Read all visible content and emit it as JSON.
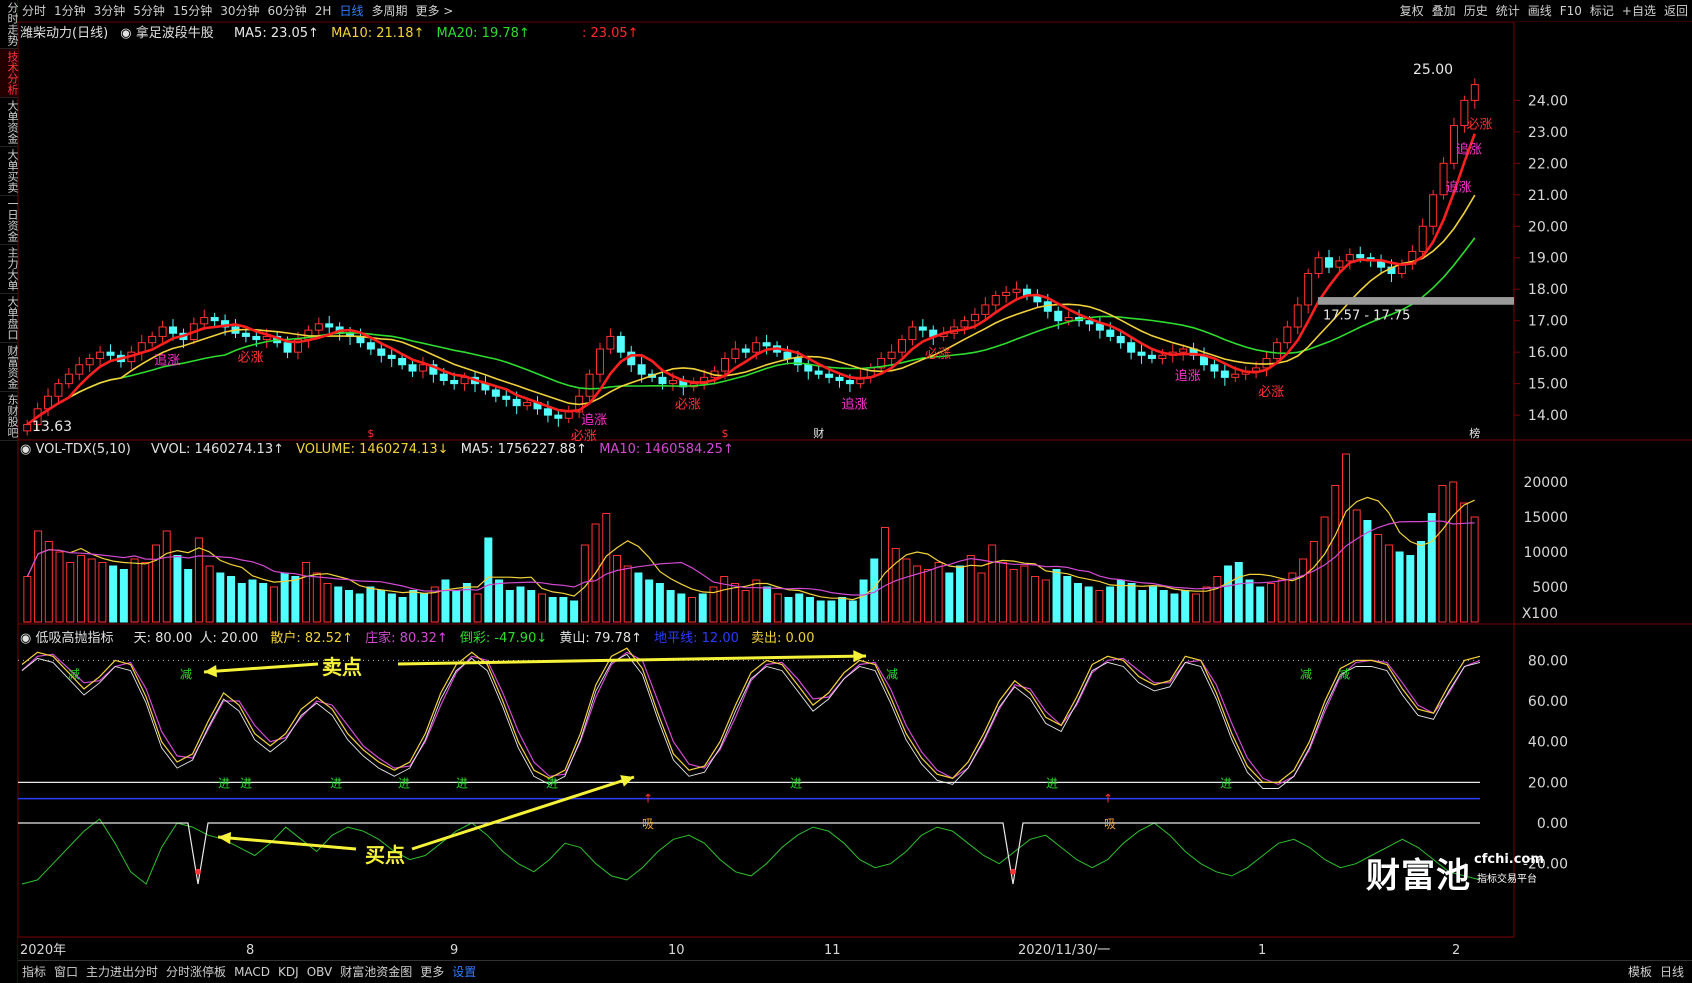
{
  "toolbar": {
    "left_items": [
      "分时",
      "1分钟",
      "3分钟",
      "5分钟",
      "15分钟",
      "30分钟",
      "60分钟",
      "2H",
      "日线",
      "多周期",
      "更多 >"
    ],
    "active": "日线",
    "right_items": [
      "复权",
      "叠加",
      "历史",
      "统计",
      "画线",
      "F10",
      "标记",
      "+自选",
      "返回"
    ]
  },
  "sidebar": {
    "items": [
      "分时走势",
      "技术分析",
      "大单资金",
      "大单买卖",
      "一日资金",
      "主力大单",
      "大单盘口",
      "财富资金",
      "东财股吧"
    ],
    "active": "技术分析"
  },
  "price_panel": {
    "legend": {
      "stock": "潍柴动力(日线)",
      "indicator": "拿足波段牛股",
      "ma5": "MA5: 23.05↑",
      "ma10": "MA10: 21.18↑",
      "ma20": "MA20: 19.78↑",
      "extra": ": 23.05↑"
    },
    "max_label": "25.00",
    "min_label": "13.63",
    "range_label": "17.57 - 17.75",
    "signals": [
      "追涨",
      "必涨",
      "必涨",
      "追涨",
      "必涨",
      "追涨",
      "必涨",
      "追涨",
      "必涨",
      "追涨",
      "必涨",
      "追涨"
    ],
    "markers": [
      "$",
      "$",
      "财",
      "榜"
    ]
  },
  "volume_panel": {
    "legend": {
      "name": "VOL-TDX(5,10)",
      "vvol": "VVOL: 1460274.13↑",
      "volume": "VOLUME: 1460274.13↓",
      "ma5": "MA5: 1756227.88↑",
      "ma10": "MA10: 1460584.25↑"
    },
    "unit": "X100"
  },
  "osc_panel": {
    "legend": {
      "name": "低吸高抛指标",
      "tian": "天: 80.00",
      "ren": "人: 20.00",
      "sanhu": "散户: 82.52↑",
      "zhuangjia": "庄家: 80.32↑",
      "daogua": "倒彩: -47.90↓",
      "huangshan": "黄山: 79.78↑",
      "dipingxian": "地平线: 12.00",
      "maichu": "卖出: 0.00"
    },
    "sell_label": "卖点",
    "buy_label": "买点",
    "jin_label": "进",
    "jian_label": "减",
    "xi_label": "吸"
  },
  "x_axis": {
    "labels": [
      "2020年",
      "8",
      "9",
      "10",
      "11",
      "2020/11/30/一",
      "1",
      "2"
    ]
  },
  "bottombar": {
    "items": [
      "指标",
      "窗口",
      "主力进出分时",
      "分时涨停板",
      "MACD",
      "KDJ",
      "OBV",
      "财富池资金图",
      "更多",
      "设置"
    ],
    "active": "设置",
    "right_items": [
      "模板",
      "日线"
    ]
  },
  "watermark": {
    "brand": "财富池",
    "domain": "cfchi.com",
    "tagline": "指标交易平台"
  },
  "chart_data": [
    {
      "type": "candlestick",
      "title": "潍柴动力(日线)",
      "y_ticks": [
        24.0,
        23.0,
        22.0,
        21.0,
        20.0,
        19.0,
        18.0,
        17.0,
        16.0,
        15.0,
        14.0
      ],
      "ylim": [
        13.4,
        25.6
      ],
      "close": [
        13.7,
        14.2,
        14.6,
        15.0,
        15.3,
        15.6,
        15.8,
        16.0,
        15.9,
        15.7,
        16.0,
        16.3,
        16.5,
        16.8,
        16.6,
        16.4,
        16.9,
        17.1,
        17.0,
        16.8,
        16.6,
        16.5,
        16.4,
        16.5,
        16.3,
        16.0,
        16.4,
        16.7,
        16.9,
        16.8,
        16.6,
        16.5,
        16.3,
        16.1,
        15.9,
        15.8,
        15.6,
        15.4,
        15.6,
        15.3,
        15.1,
        15.0,
        15.2,
        15.0,
        14.8,
        14.6,
        14.5,
        14.3,
        14.4,
        14.2,
        14.0,
        13.9,
        14.1,
        14.6,
        15.3,
        16.1,
        16.5,
        16.0,
        15.6,
        15.3,
        15.2,
        15.0,
        15.1,
        14.9,
        15.0,
        15.2,
        15.4,
        15.8,
        16.1,
        16.0,
        16.3,
        16.2,
        16.0,
        15.8,
        15.6,
        15.4,
        15.3,
        15.2,
        15.1,
        15.0,
        15.2,
        15.5,
        15.8,
        16.0,
        16.4,
        16.8,
        16.7,
        16.5,
        16.6,
        16.8,
        17.0,
        17.2,
        17.5,
        17.8,
        17.9,
        18.0,
        17.8,
        17.6,
        17.3,
        17.0,
        17.1,
        17.0,
        16.9,
        16.7,
        16.5,
        16.3,
        16.0,
        15.9,
        15.8,
        15.9,
        16.0,
        16.1,
        15.9,
        15.6,
        15.4,
        15.2,
        15.3,
        15.4,
        15.5,
        15.8,
        16.3,
        16.8,
        17.5,
        18.5,
        19.0,
        18.7,
        18.9,
        19.1,
        19.0,
        18.9,
        18.7,
        18.5,
        18.8,
        19.2,
        20.0,
        21.0,
        22.0,
        23.2,
        24.0,
        24.5
      ],
      "ma_lines": [
        "MA5",
        "MA10",
        "MA20"
      ]
    },
    {
      "type": "bar",
      "title": "VOL-TDX(5,10)",
      "y_ticks": [
        20000,
        15000,
        10000,
        5000
      ],
      "ylim": [
        0,
        24000
      ],
      "unit": "X100",
      "values": [
        6500,
        13000,
        11500,
        10000,
        8500,
        9500,
        9000,
        8500,
        8000,
        7500,
        9000,
        8500,
        11000,
        13000,
        9500,
        7500,
        12000,
        8000,
        7000,
        6500,
        5500,
        6000,
        5500,
        5000,
        7000,
        6500,
        8500,
        7000,
        5500,
        5000,
        4500,
        4000,
        5000,
        4500,
        4000,
        3500,
        4500,
        4000,
        5000,
        6000,
        4500,
        5500,
        4000,
        12000,
        6000,
        4500,
        5000,
        4500,
        4000,
        3500,
        3500,
        3000,
        11000,
        14000,
        15500,
        9500,
        8000,
        7000,
        6000,
        5500,
        4500,
        4000,
        3500,
        4000,
        5000,
        6500,
        5500,
        4500,
        6000,
        5000,
        4000,
        3500,
        4000,
        3500,
        3000,
        3000,
        3500,
        3000,
        6000,
        9000,
        13500,
        10500,
        9000,
        8000,
        7500,
        8500,
        7000,
        8000,
        9500,
        7000,
        11000,
        8500,
        7500,
        8000,
        6500,
        6000,
        7500,
        6500,
        5500,
        5000,
        4500,
        5000,
        6000,
        5500,
        4500,
        5000,
        4500,
        4000,
        4500,
        4000,
        5000,
        6500,
        8000,
        8500,
        6000,
        5000,
        5500,
        6000,
        7000,
        9000,
        11500,
        15000,
        19500,
        24000,
        16000,
        14500,
        12500,
        11000,
        10000,
        9500,
        11500,
        15500,
        19500,
        20000,
        17000,
        15000
      ],
      "series": [
        {
          "name": "MA5"
        },
        {
          "name": "MA10"
        }
      ]
    },
    {
      "type": "line",
      "title": "低吸高抛指标",
      "y_ticks": [
        80.0,
        60.0,
        40.0,
        20.0,
        0.0,
        -20.0
      ],
      "ylim": [
        -30,
        92
      ],
      "series": [
        {
          "name": "散户",
          "values": [
            78,
            84,
            82,
            74,
            66,
            72,
            80,
            78,
            62,
            40,
            30,
            34,
            50,
            64,
            58,
            44,
            38,
            44,
            56,
            62,
            56,
            44,
            36,
            30,
            26,
            30,
            44,
            64,
            78,
            84,
            78,
            60,
            40,
            26,
            22,
            26,
            44,
            68,
            82,
            86,
            76,
            54,
            34,
            26,
            28,
            40,
            58,
            74,
            80,
            78,
            68,
            58,
            64,
            74,
            80,
            78,
            62,
            44,
            32,
            24,
            22,
            30,
            44,
            60,
            70,
            64,
            52,
            48,
            62,
            78,
            82,
            80,
            72,
            68,
            70,
            82,
            80,
            64,
            44,
            28,
            20,
            20,
            26,
            40,
            60,
            76,
            80,
            80,
            78,
            66,
            56,
            54,
            68,
            80,
            82
          ]
        },
        {
          "name": "庄家",
          "values": [
            75,
            82,
            83,
            76,
            69,
            70,
            77,
            79,
            66,
            45,
            33,
            32,
            46,
            60,
            60,
            48,
            40,
            42,
            52,
            60,
            58,
            48,
            38,
            32,
            27,
            28,
            40,
            58,
            74,
            82,
            80,
            64,
            45,
            30,
            23,
            24,
            40,
            62,
            78,
            84,
            80,
            60,
            40,
            29,
            27,
            36,
            52,
            70,
            78,
            79,
            71,
            61,
            62,
            71,
            78,
            79,
            66,
            48,
            35,
            26,
            22,
            27,
            40,
            56,
            68,
            66,
            55,
            48,
            58,
            74,
            80,
            81,
            75,
            69,
            69,
            79,
            80,
            68,
            49,
            32,
            22,
            19,
            23,
            36,
            55,
            72,
            79,
            80,
            79,
            69,
            58,
            54,
            64,
            77,
            80
          ]
        },
        {
          "name": "黄山",
          "values": [
            -30,
            -28,
            -20,
            -12,
            -4,
            2,
            -10,
            -24,
            -30,
            -12,
            0,
            -2,
            -6,
            -8,
            -12,
            -16,
            -10,
            -2,
            -8,
            -14,
            -6,
            -2,
            -4,
            -8,
            -14,
            -18,
            -16,
            -10,
            -4,
            0,
            -6,
            -14,
            -20,
            -24,
            -18,
            -10,
            -12,
            -20,
            -26,
            -28,
            -22,
            -14,
            -8,
            -6,
            -10,
            -18,
            -24,
            -26,
            -20,
            -12,
            -6,
            -2,
            -4,
            -10,
            -18,
            -22,
            -20,
            -14,
            -6,
            -2,
            -4,
            -10,
            -16,
            -20,
            -14,
            -8,
            -6,
            -12,
            -18,
            -22,
            -18,
            -10,
            -4,
            0,
            -6,
            -14,
            -20,
            -24,
            -26,
            -22,
            -16,
            -10,
            -8,
            -12,
            -18,
            -22,
            -20,
            -16,
            -12,
            -8,
            -12,
            -18,
            -24,
            -26,
            -28
          ]
        }
      ],
      "reference_lines": [
        {
          "name": "天",
          "value": 80
        },
        {
          "name": "人",
          "value": 20
        },
        {
          "name": "地平线",
          "value": 12
        }
      ]
    }
  ]
}
